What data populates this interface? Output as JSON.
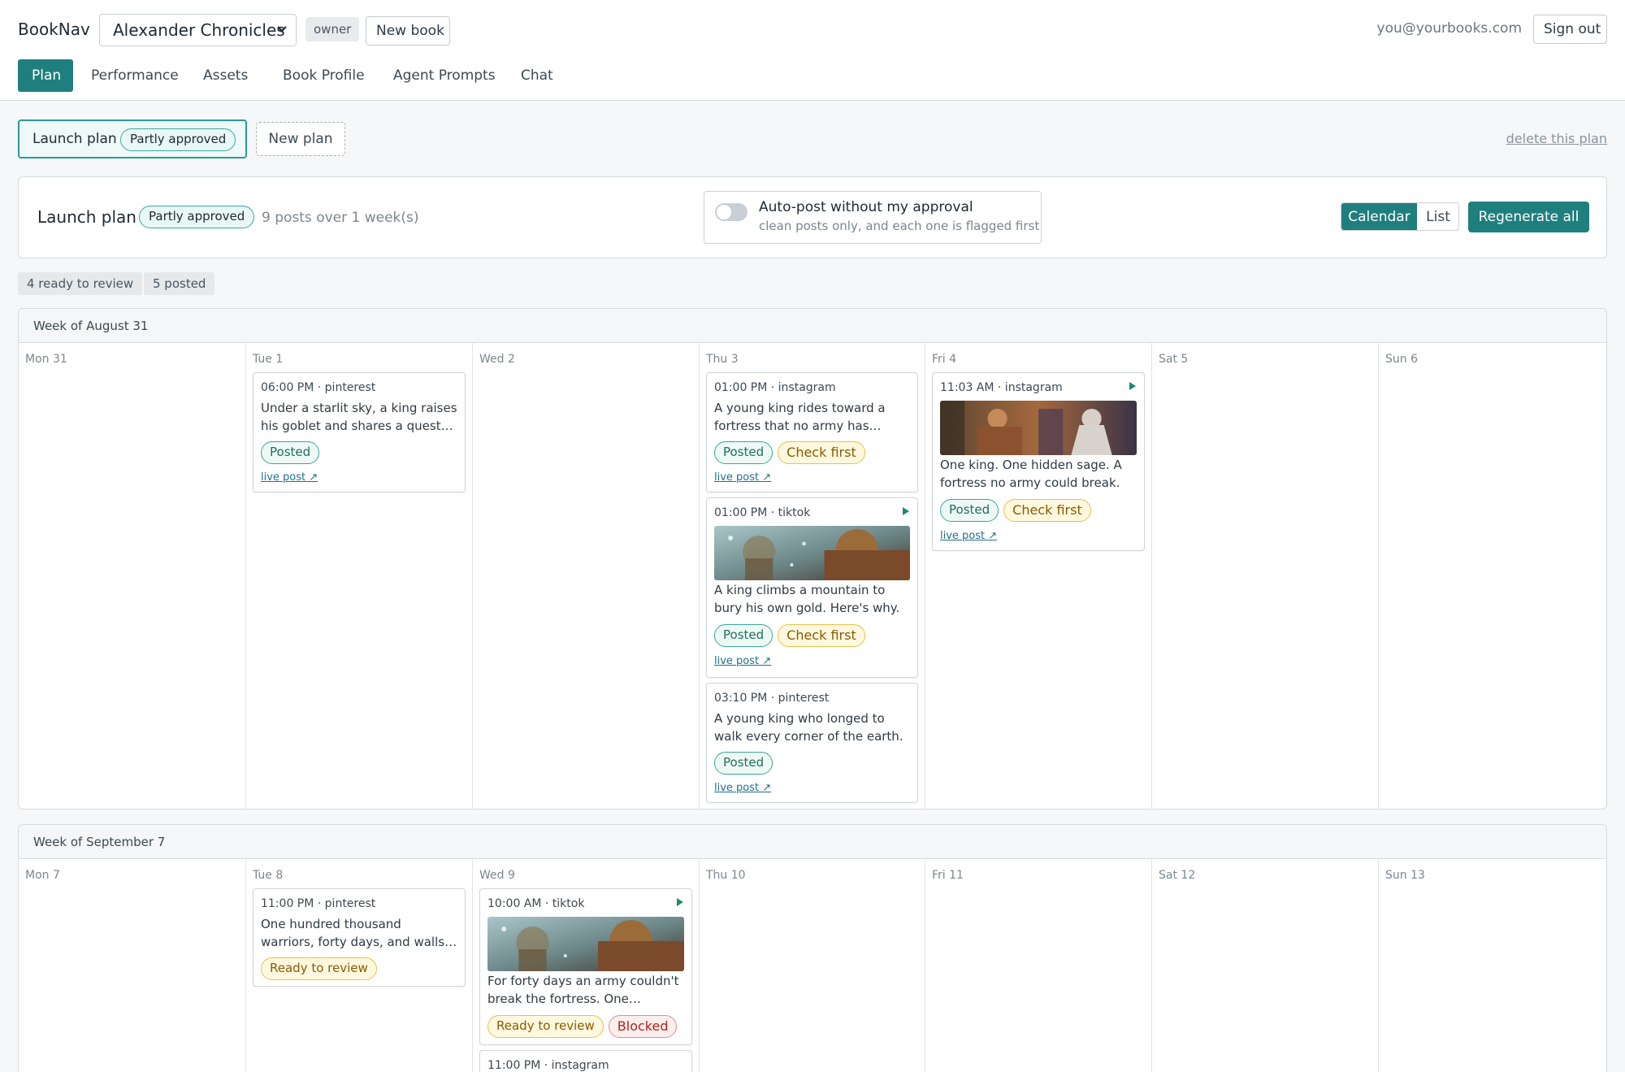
{
  "header": {
    "brand": "BookNav",
    "book_select_value": "Alexander Chronicles",
    "role_badge": "owner",
    "new_book_label": "New book",
    "user_email": "you@yourbooks.com",
    "sign_out_label": "Sign out"
  },
  "tabs": [
    {
      "label": "Plan",
      "active": true
    },
    {
      "label": "Performance",
      "active": false
    },
    {
      "label": "Assets",
      "active": false
    },
    {
      "label": "Book Profile",
      "active": false
    },
    {
      "label": "Agent Prompts",
      "active": false
    },
    {
      "label": "Chat",
      "active": false
    }
  ],
  "plan_selector": {
    "active_plan_name": "Launch plan",
    "active_plan_status": "Partly approved",
    "new_plan_label": "New plan",
    "delete_label": "delete this plan"
  },
  "plan_card": {
    "title": "Launch plan",
    "status": "Partly approved",
    "summary": "9 posts over 1 week(s)",
    "autopost_label": "Auto-post without my approval",
    "autopost_sub": "clean posts only, and each one is flagged first",
    "autopost_enabled": false,
    "view_calendar": "Calendar",
    "view_list": "List",
    "active_view": "Calendar",
    "regenerate_label": "Regenerate all"
  },
  "stats": {
    "ready": "4 ready to review",
    "posted": "5 posted"
  },
  "colors": {
    "accent": "#1f7f7e",
    "posted": "#3aa89a",
    "check_first": "#e8c24a",
    "blocked": "#e08d8d"
  },
  "weeks": [
    {
      "title": "Week of August 31",
      "days": [
        {
          "label": "Mon 31",
          "posts": []
        },
        {
          "label": "Tue 1",
          "posts": [
            {
              "time": "06:00 PM · pinterest",
              "caption": "Under a starlit sky, a king raises his goblet and shares a quest…",
              "statuses": [
                "Posted"
              ],
              "link": "live post ↗"
            }
          ]
        },
        {
          "label": "Wed 2",
          "posts": []
        },
        {
          "label": "Thu 3",
          "posts": [
            {
              "time": "01:00 PM · instagram",
              "caption": "A young king rides toward a fortress that no army has ever…",
              "statuses": [
                "Posted",
                "Check first"
              ],
              "link": "live post ↗"
            },
            {
              "time": "01:00 PM · tiktok",
              "caption": "A king climbs a mountain to bury his own gold. Here's why.",
              "statuses": [
                "Posted",
                "Check first"
              ],
              "link": "live post ↗",
              "video": true
            },
            {
              "time": "03:10 PM · pinterest",
              "caption": "A young king who longed to walk every corner of the earth.",
              "statuses": [
                "Posted"
              ],
              "link": "live post ↗"
            }
          ]
        },
        {
          "label": "Fri 4",
          "posts": [
            {
              "time": "11:03 AM · instagram",
              "caption": "One king. One hidden sage. A fortress no army could break.",
              "statuses": [
                "Posted",
                "Check first"
              ],
              "link": "live post ↗",
              "video": true
            }
          ]
        },
        {
          "label": "Sat 5",
          "posts": []
        },
        {
          "label": "Sun 6",
          "posts": []
        }
      ]
    },
    {
      "title": "Week of September 7",
      "days": [
        {
          "label": "Mon 7",
          "posts": []
        },
        {
          "label": "Tue 8",
          "posts": [
            {
              "time": "11:00 PM · pinterest",
              "caption": "One hundred thousand warriors, forty days, and walls that woul…",
              "statuses": [
                "Ready to review"
              ]
            }
          ]
        },
        {
          "label": "Wed 9",
          "posts": [
            {
              "time": "10:00 AM · tiktok",
              "caption": "For forty days an army couldn't break the fortress. One prayer…",
              "statuses": [
                "Ready to review",
                "Blocked"
              ],
              "video": true
            },
            {
              "time": "11:00 PM · instagram"
            }
          ]
        },
        {
          "label": "Thu 10",
          "posts": []
        },
        {
          "label": "Fri 11",
          "posts": []
        },
        {
          "label": "Sat 12",
          "posts": []
        },
        {
          "label": "Sun 13",
          "posts": []
        }
      ]
    }
  ]
}
